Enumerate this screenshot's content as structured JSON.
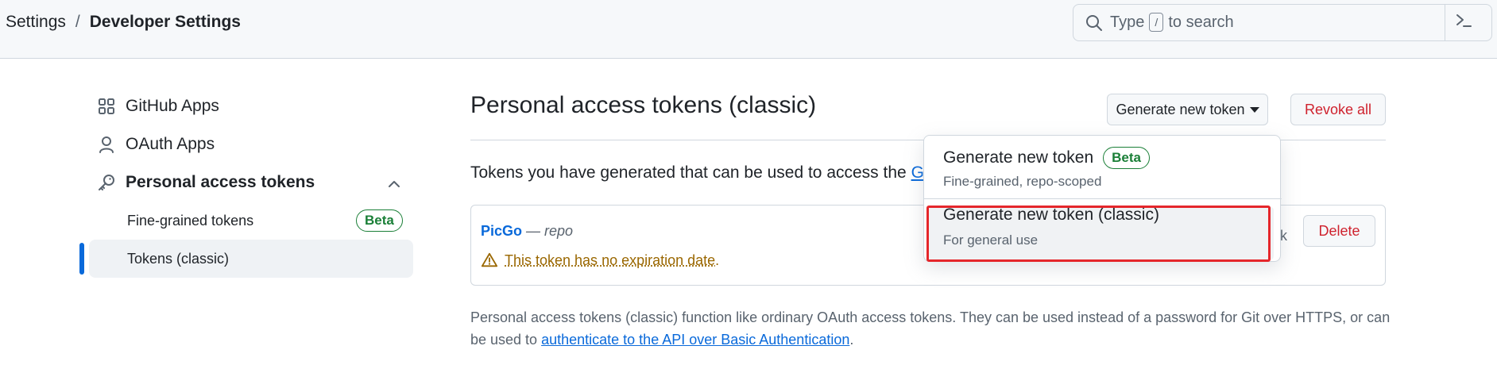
{
  "header": {
    "breadcrumb": [
      "Settings",
      "/",
      "Developer Settings"
    ],
    "search": {
      "prefix": "Type",
      "key": "/",
      "suffix": "to search"
    }
  },
  "sidebar": {
    "items": [
      {
        "label": "GitHub Apps",
        "icon": "apps-grid-icon"
      },
      {
        "label": "OAuth Apps",
        "icon": "person-icon"
      },
      {
        "label": "Personal access tokens",
        "icon": "key-icon",
        "expanded": true
      }
    ],
    "subitems": [
      {
        "label": "Fine-grained tokens",
        "badge": "Beta"
      },
      {
        "label": "Tokens (classic)",
        "active": true
      }
    ]
  },
  "main": {
    "title": "Personal access tokens (classic)",
    "generate_button": "Generate new token",
    "revoke_button": "Revoke all",
    "intro_text": "Tokens you have generated that can be used to access the",
    "intro_link": "Git",
    "token": {
      "name": "PicGo",
      "separator": " — ",
      "scope": "repo",
      "warning": "This token has no expiration date",
      "warning_suffix": ".",
      "partial_text": "k",
      "delete_button": "Delete"
    },
    "footer_text": "Personal access tokens (classic) function like ordinary OAuth access tokens. They can be used instead of a password for Git over HTTPS, or can be used to",
    "footer_link": "authenticate to the API over Basic Authentication",
    "footer_suffix": "."
  },
  "dropdown": {
    "items": [
      {
        "title": "Generate new token",
        "badge": "Beta",
        "desc": "Fine-grained, repo-scoped"
      },
      {
        "title": "Generate new token (classic)",
        "desc": "For general use",
        "highlighted": true
      }
    ]
  },
  "colors": {
    "accent": "#0969da",
    "danger": "#cf222e",
    "success": "#1a7f37",
    "warning": "#9a6700",
    "highlight_box": "#e5262b"
  }
}
